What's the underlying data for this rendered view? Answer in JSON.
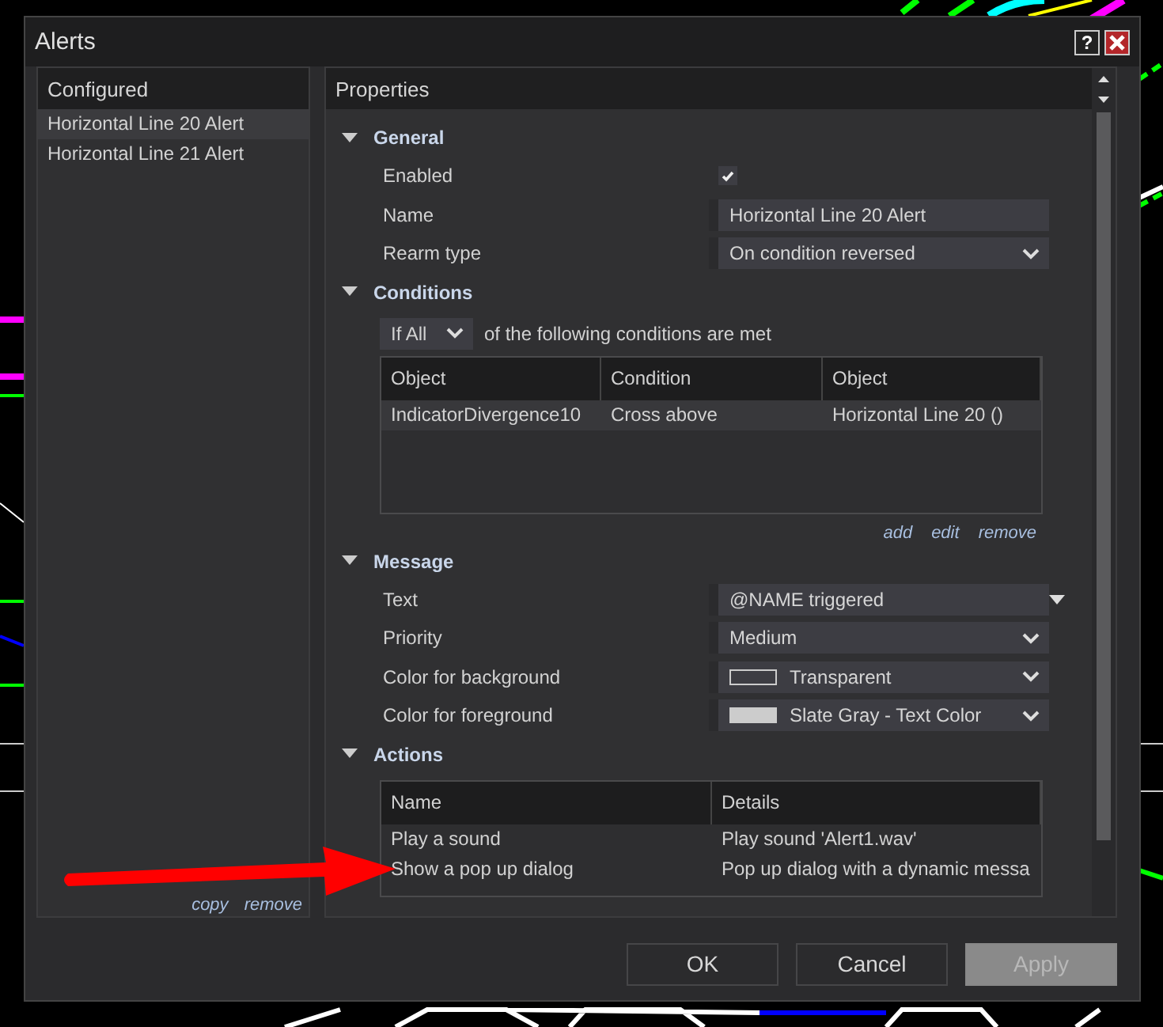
{
  "window": {
    "title": "Alerts",
    "help": "?"
  },
  "configured": {
    "title": "Configured",
    "items": [
      {
        "label": "Horizontal Line 20 Alert",
        "selected": true
      },
      {
        "label": "Horizontal Line 21 Alert",
        "selected": false
      }
    ],
    "links": [
      "copy",
      "remove"
    ]
  },
  "properties": {
    "title": "Properties",
    "sections": [
      {
        "kind": "fields",
        "title": "General",
        "expanded": true,
        "rows": [
          {
            "label": "Enabled",
            "kind": "checkbox",
            "checked": true
          },
          {
            "label": "Name",
            "kind": "text",
            "value": "Horizontal Line 20 Alert"
          },
          {
            "label": "Rearm type",
            "kind": "select",
            "value": "On condition reversed"
          }
        ]
      },
      {
        "kind": "conditions",
        "title": "Conditions",
        "expanded": true,
        "match": "If All",
        "match_text": "of the following conditions are met",
        "columns": [
          "Object",
          "Condition",
          "Object"
        ],
        "rows": [
          [
            "IndicatorDivergence10",
            "Cross above",
            "Horizontal Line 20 ()"
          ]
        ],
        "links": [
          "add",
          "edit",
          "remove"
        ]
      },
      {
        "kind": "fields",
        "title": "Message",
        "expanded": true,
        "rows": [
          {
            "label": "Text",
            "kind": "combo",
            "value": "@NAME triggered"
          },
          {
            "label": "Priority",
            "kind": "select",
            "value": "Medium"
          },
          {
            "label": "Color for background",
            "kind": "color",
            "value": "Transparent"
          },
          {
            "label": "Color for foreground",
            "kind": "color",
            "value": "Slate Gray - Text Color",
            "color": "#cccccc"
          }
        ]
      },
      {
        "kind": "table",
        "title": "Actions",
        "expanded": true,
        "columns": [
          "Name",
          "Details"
        ],
        "rows": [
          [
            "Play a sound",
            "Play sound 'Alert1.wav'"
          ],
          [
            "Show a pop up dialog",
            "Pop up dialog with a dynamic messa"
          ]
        ]
      }
    ]
  },
  "buttons": [
    {
      "label": "OK",
      "disabled": false
    },
    {
      "label": "Cancel",
      "disabled": false
    },
    {
      "label": "Apply",
      "disabled": true
    }
  ]
}
